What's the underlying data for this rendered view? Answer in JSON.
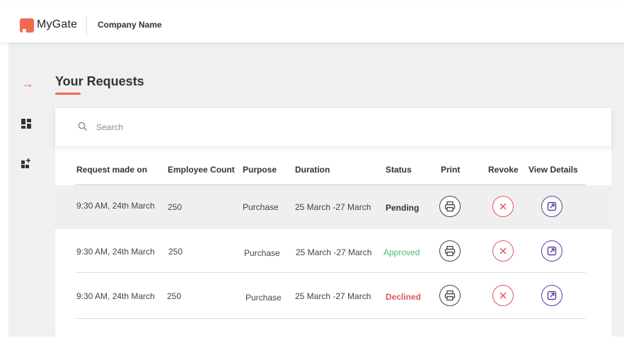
{
  "header": {
    "logo_text": "MyGate",
    "company": "Company Name"
  },
  "page": {
    "title": "Your Requests"
  },
  "search": {
    "placeholder": "Search"
  },
  "table": {
    "columns": [
      "Request made on",
      "Employee Count",
      "Purpose",
      "Duration",
      "Status",
      "Print",
      "Revoke",
      "View Details"
    ],
    "rows": [
      {
        "request_made_on": "9:30 AM, 24th March",
        "employee_count": "250",
        "purpose": "Purchase",
        "duration": "25 March -27 March",
        "status": "Pending"
      },
      {
        "request_made_on": "9:30 AM, 24th March",
        "employee_count": "250",
        "purpose": "Purchase",
        "duration": "25 March -27 March",
        "status": "Approved"
      },
      {
        "request_made_on": "9:30 AM, 24th March",
        "employee_count": "250",
        "purpose": "Purchase",
        "duration": "25 March -27 March",
        "status": "Declined"
      }
    ]
  },
  "colors": {
    "accent": "#ef6a4f",
    "pending": "#333333",
    "approved": "#4cb96a",
    "declined": "#e0575b",
    "revoke": "#e0575b",
    "view": "#5b3f9a"
  },
  "icons": {
    "rail": [
      "arrow-right-icon",
      "dashboard-icon",
      "dashboard-add-icon"
    ],
    "row_actions": [
      "printer-icon",
      "close-circle-icon",
      "external-link-icon"
    ]
  }
}
